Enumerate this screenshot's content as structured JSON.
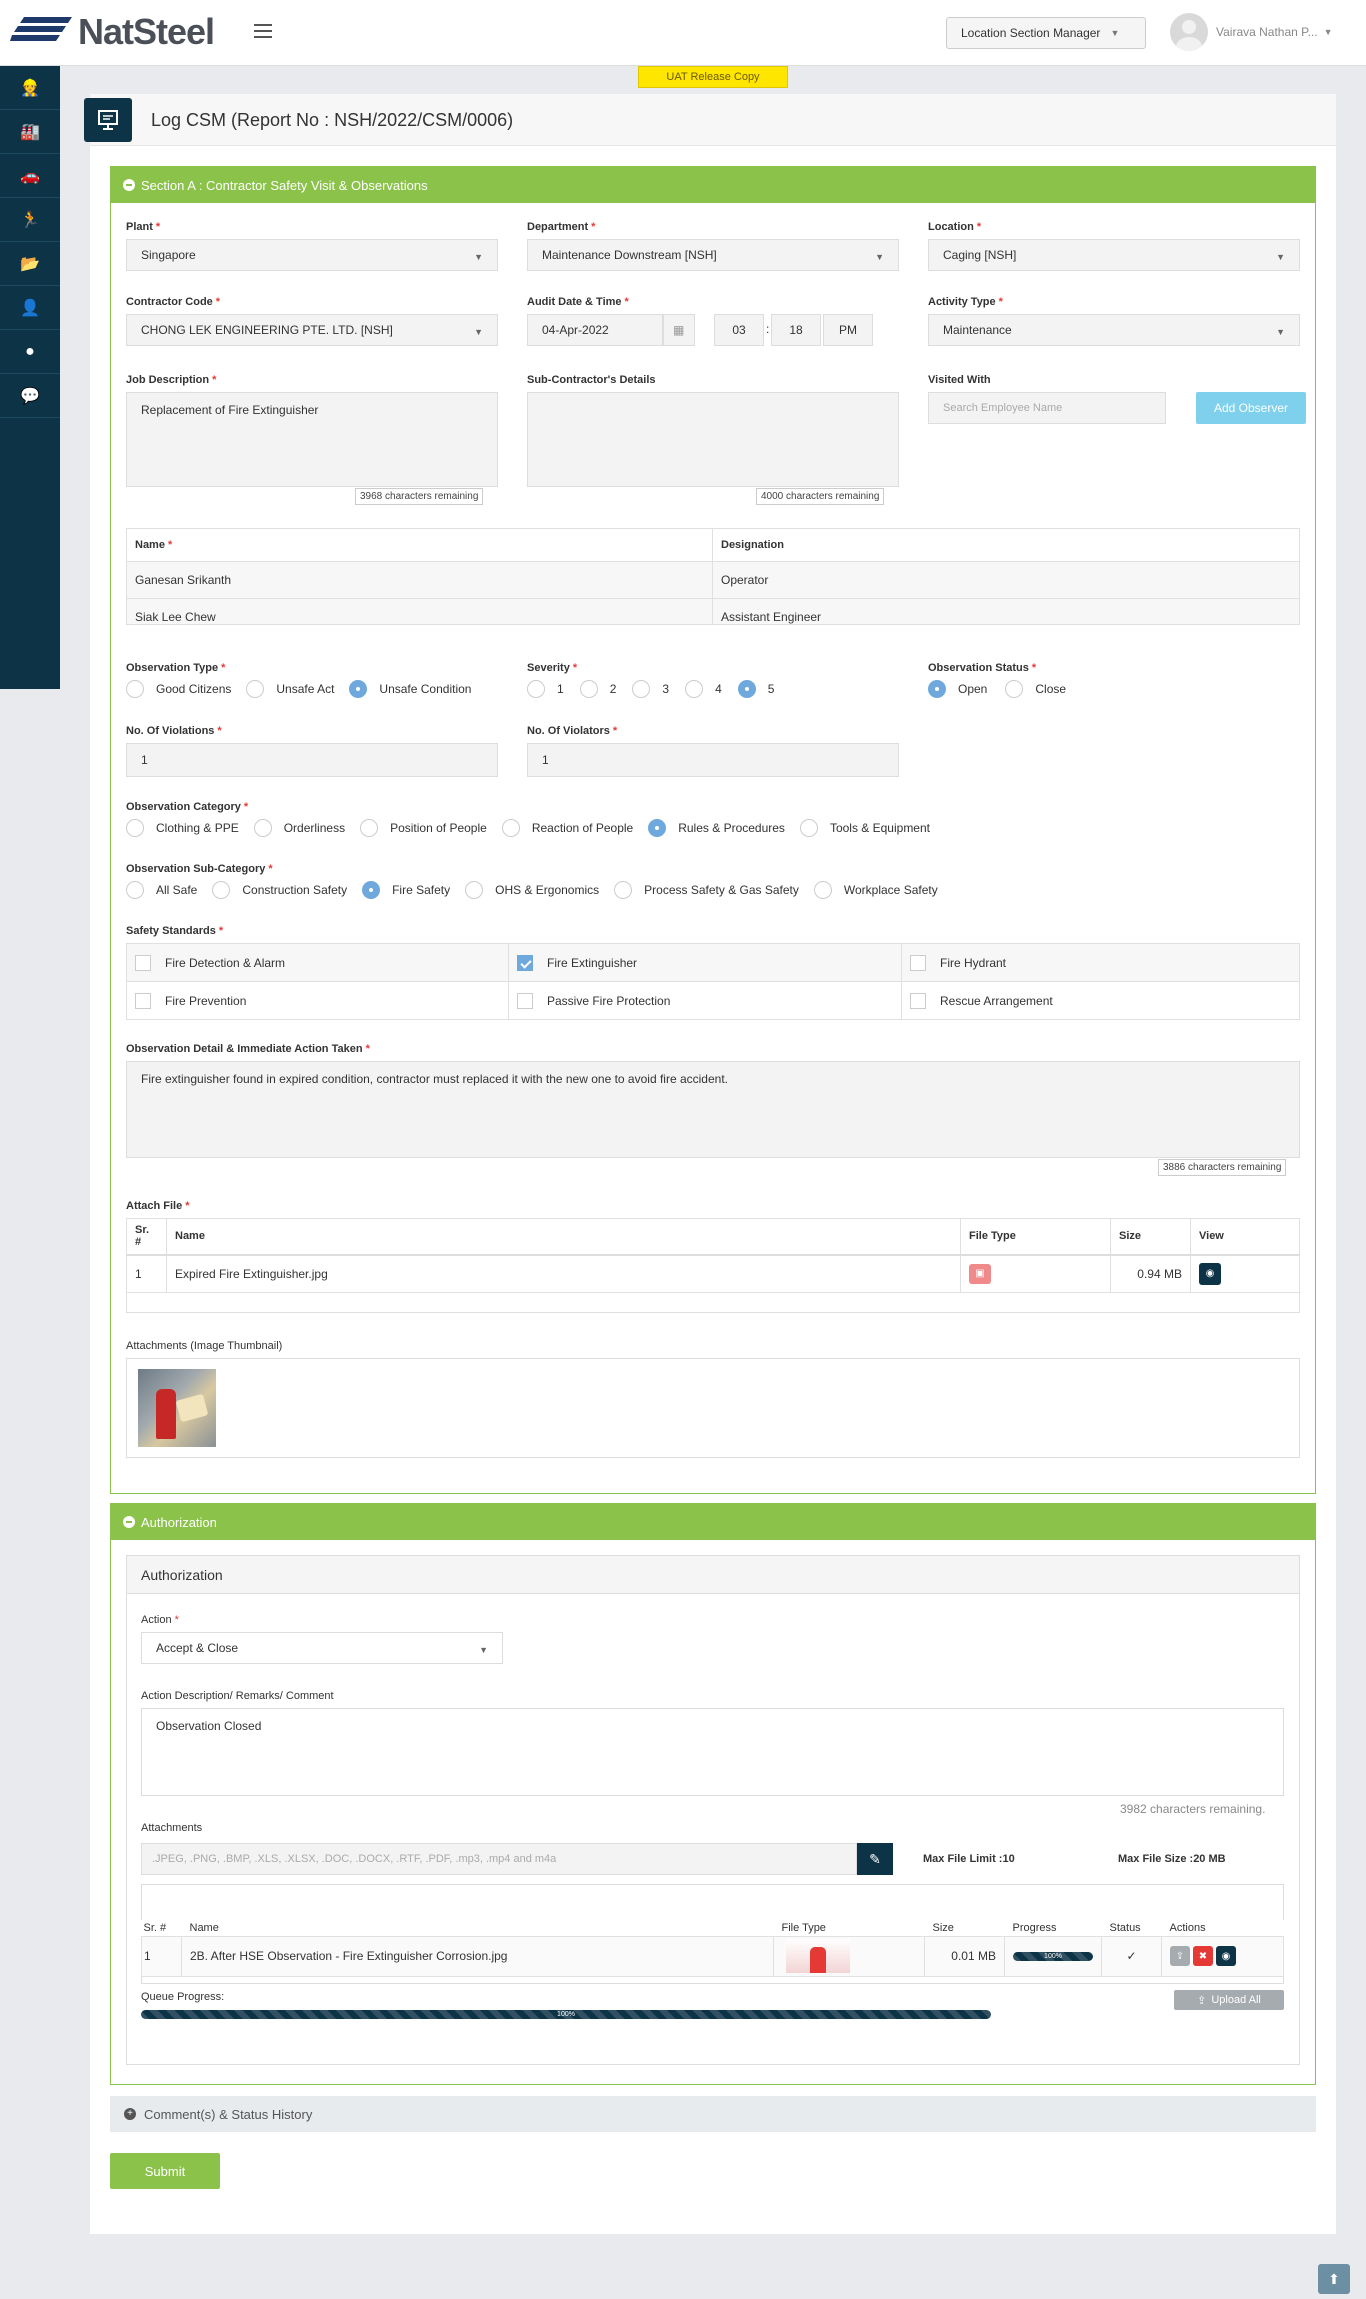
{
  "app": {
    "logo": "NatSteel",
    "uat_badge": "UAT Release Copy"
  },
  "header": {
    "role": "Location Section Manager",
    "user": "Vairava Nathan P..."
  },
  "page": {
    "title": "Log CSM (Report No : NSH/2022/CSM/0006)"
  },
  "sectionA": {
    "title": "Section A : Contractor Safety Visit & Observations",
    "plant": {
      "label": "Plant",
      "value": "Singapore"
    },
    "department": {
      "label": "Department",
      "value": "Maintenance Downstream [NSH]"
    },
    "location": {
      "label": "Location",
      "value": "Caging [NSH]"
    },
    "contractor": {
      "label": "Contractor Code",
      "value": "CHONG LEK ENGINEERING PTE. LTD. [NSH]"
    },
    "audit": {
      "label": "Audit Date & Time",
      "date": "04-Apr-2022",
      "hour": "03",
      "sep": ":",
      "minute": "18",
      "ampm": "PM"
    },
    "activity": {
      "label": "Activity Type",
      "value": "Maintenance"
    },
    "job": {
      "label": "Job Description",
      "value": "Replacement of Fire Extinguisher",
      "counter": "3968 characters remaining"
    },
    "subcontractor": {
      "label": "Sub-Contractor's Details",
      "value": "",
      "counter": "4000 characters remaining"
    },
    "visited": {
      "label": "Visited With",
      "placeholder": "Search Employee Name",
      "button": "Add Observer"
    },
    "observers": {
      "headers": [
        "Name",
        "Designation"
      ],
      "rows": [
        [
          "Ganesan Srikanth",
          "Operator"
        ],
        [
          "Siak Lee Chew",
          "Assistant Engineer"
        ]
      ]
    },
    "obs_type": {
      "label": "Observation Type",
      "options": [
        "Good Citizens",
        "Unsafe Act",
        "Unsafe Condition"
      ],
      "selected": 2
    },
    "severity": {
      "label": "Severity",
      "options": [
        "1",
        "2",
        "3",
        "4",
        "5"
      ],
      "selected": 4
    },
    "obs_status": {
      "label": "Observation Status",
      "options": [
        "Open",
        "Close"
      ],
      "selected": 0
    },
    "violations": {
      "label": "No. Of Violations",
      "value": "1"
    },
    "violators": {
      "label": "No. Of Violators",
      "value": "1"
    },
    "category": {
      "label": "Observation Category",
      "options": [
        "Clothing & PPE",
        "Orderliness",
        "Position of People",
        "Reaction of People",
        "Rules & Procedures",
        "Tools & Equipment"
      ],
      "selected": 4
    },
    "subcategory": {
      "label": "Observation Sub-Category",
      "options": [
        "All Safe",
        "Construction Safety",
        "Fire Safety",
        "OHS & Ergonomics",
        "Process Safety & Gas Safety",
        "Workplace Safety"
      ],
      "selected": 2
    },
    "standards": {
      "label": "Safety Standards",
      "items": [
        "Fire Detection & Alarm",
        "Fire Extinguisher",
        "Fire Hydrant",
        "Fire Prevention",
        "Passive Fire Protection",
        "Rescue Arrangement"
      ],
      "checked": [
        1
      ]
    },
    "detail": {
      "label": "Observation Detail & Immediate Action Taken",
      "value": "Fire extinguisher found in expired condition, contractor must replaced it with the new one to avoid fire accident.",
      "counter": "3886 characters remaining"
    },
    "attach": {
      "label": "Attach File",
      "headers": [
        "Sr. #",
        "Name",
        "File Type",
        "Size",
        "View"
      ],
      "rows": [
        {
          "sr": "1",
          "name": "Expired Fire Extinguisher.jpg",
          "size": "0.94 MB"
        }
      ]
    },
    "thumbs_label": "Attachments (Image Thumbnail)"
  },
  "auth": {
    "title": "Authorization",
    "subtitle": "Authorization",
    "action": {
      "label": "Action",
      "value": "Accept & Close"
    },
    "remarks": {
      "label": "Action Description/ Remarks/ Comment",
      "value": "Observation Closed",
      "counter": "3982 characters remaining."
    },
    "attachments": {
      "label": "Attachments",
      "placeholder": ".JPEG, .PNG, .BMP, .XLS, .XLSX, .DOC, .DOCX, .RTF, .PDF, .mp3, .mp4 and m4a",
      "max_limit": "Max File Limit :10",
      "max_size": "Max File Size :20 MB",
      "headers": [
        "Sr. #",
        "Name",
        "File Type",
        "Size",
        "Progress",
        "Status",
        "Actions"
      ],
      "rows": [
        {
          "sr": "1",
          "name": "2B. After HSE Observation - Fire Extinguisher Corrosion.jpg",
          "size": "0.01 MB",
          "progress": "100%",
          "status": "✓"
        }
      ],
      "queue_label": "Queue Progress:",
      "queue_value": "100%",
      "upload_all": "Upload All"
    }
  },
  "comments": {
    "title": "Comment(s) & Status History"
  },
  "submit": "Submit"
}
